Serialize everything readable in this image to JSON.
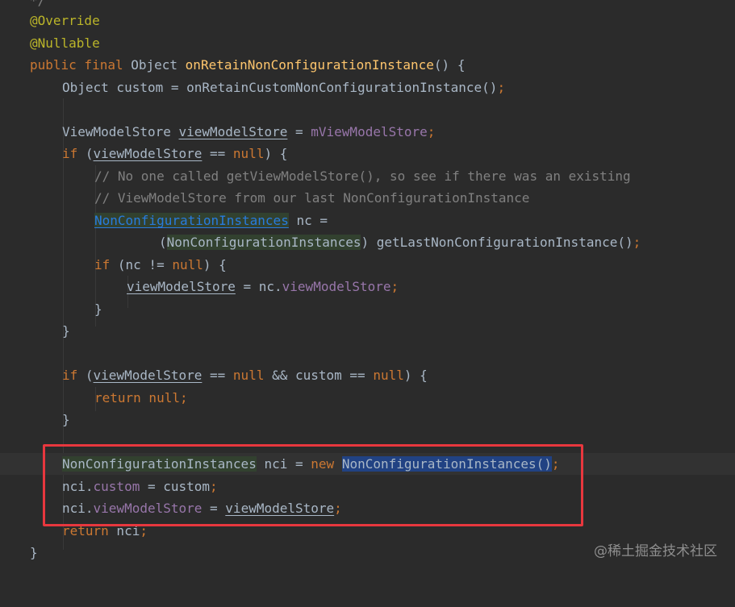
{
  "editor": {
    "lines": {
      "l0": "*/",
      "l1_ann": "@Override",
      "l2_ann": "@Nullable",
      "l3_kw": "public final",
      "l3_type": "Object",
      "l3_fn": "onRetainNonConfigurationInstance",
      "l3_rest": "() {",
      "l4_a": "Object custom = ",
      "l4_fn": "onRetainCustomNonConfigurationInstance",
      "l4_b": "()",
      "l4_semi": ";",
      "l6_a": "ViewModelStore ",
      "l6_var": "viewModelStore",
      "l6_b": " = ",
      "l6_field": "mViewModelStore",
      "l6_semi": ";",
      "l7_kw": "if",
      "l7_a": " (",
      "l7_var": "viewModelStore",
      "l7_b": " == ",
      "l7_null": "null",
      "l7_c": ") {",
      "l8_cmt": "// No one called getViewModelStore(), so see if there was an existing",
      "l9_cmt": "// ViewModelStore from our last NonConfigurationInstance",
      "l10_link": "NonConfigurationInstances",
      "l10_rest": " nc =",
      "l11_a": "(",
      "l11_type": "NonConfigurationInstances",
      "l11_b": ") getLastNonConfigurationInstance()",
      "l11_semi": ";",
      "l12_kw": "if",
      "l12_a": " (nc != ",
      "l12_null": "null",
      "l12_b": ") {",
      "l13_var": "viewModelStore",
      "l13_a": " = nc.",
      "l13_field": "viewModelStore",
      "l13_semi": ";",
      "l14": "}",
      "l15": "}",
      "l17_kw": "if",
      "l17_a": " (",
      "l17_var": "viewModelStore",
      "l17_b": " == ",
      "l17_null1": "null",
      "l17_c": " && custom == ",
      "l17_null2": "null",
      "l17_d": ") {",
      "l18_kw": "return null",
      "l18_semi": ";",
      "l19": "}",
      "l21_type": "NonConfigurationInstances",
      "l21_a": " nci = ",
      "l21_kw": "new",
      "l21_sp": " ",
      "l21_ctor": "NonConfigurationInstances",
      "l21_b": "()",
      "l21_semi": ";",
      "l22_a": "nci.",
      "l22_field": "custom",
      "l22_b": " = custom",
      "l22_semi": ";",
      "l23_a": "nci.",
      "l23_field": "viewModelStore",
      "l23_b": " = ",
      "l23_var": "viewModelStore",
      "l23_semi": ";",
      "l24_kw": "return",
      "l24_a": " nci",
      "l24_semi": ";",
      "l25": "}"
    }
  },
  "watermark": "@稀土掘金技术社区",
  "colors": {
    "background": "#2b2b2b",
    "keyword": "#cc7832",
    "annotation": "#bbb529",
    "method": "#ffc66d",
    "field": "#9876aa",
    "comment": "#808080",
    "highlight_box": "#e8373e"
  }
}
